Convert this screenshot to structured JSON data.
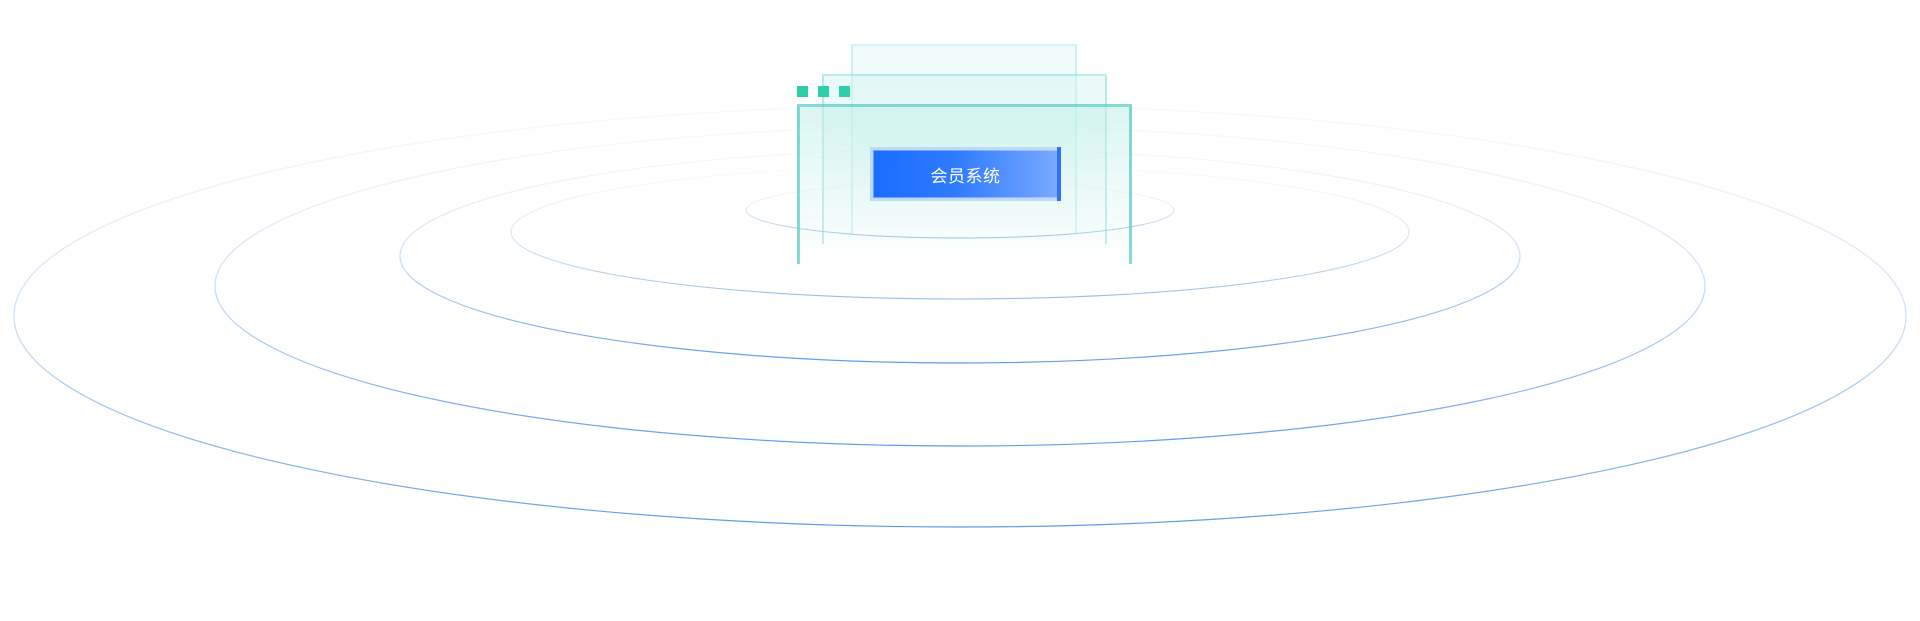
{
  "hero": {
    "button_label": "会员系统"
  },
  "colors": {
    "accent_blue": "#1a6cff",
    "teal_dots": "#2ccfa8",
    "panel_outline": "#5ccdc4",
    "ring_blue": "#7fb3ee"
  },
  "decor": {
    "dot_count": 3,
    "panel_layers": 3,
    "ring_count": 5
  }
}
